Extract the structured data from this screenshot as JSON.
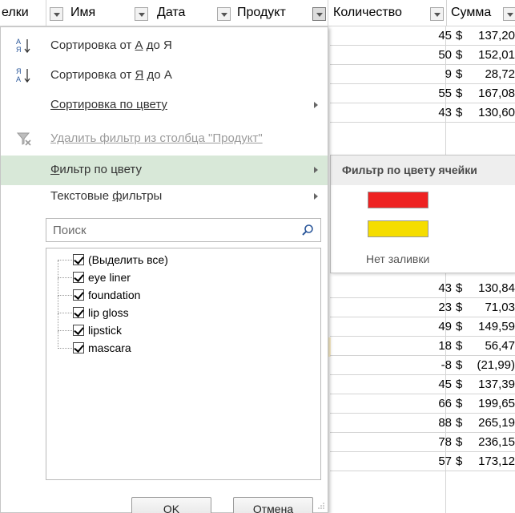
{
  "headers": {
    "col1": "елки",
    "col2": "Имя",
    "col3": "Дата",
    "col4": "Продукт",
    "col5": "Количество",
    "col6": "Сумма"
  },
  "grid_rows": [
    {
      "qty": "45",
      "amt": "137,20"
    },
    {
      "qty": "50",
      "amt": "152,01"
    },
    {
      "qty": "9",
      "amt": " 28,72"
    },
    {
      "qty": "55",
      "amt": "167,08"
    },
    {
      "qty": "43",
      "amt": "130,60"
    },
    {
      "qty": "43",
      "amt": "130,84"
    },
    {
      "qty": "23",
      "amt": " 71,03"
    },
    {
      "qty": "49",
      "amt": "149,59"
    },
    {
      "qty": "18",
      "amt": " 56,47"
    },
    {
      "qty": "-8",
      "amt": "(21,99)"
    },
    {
      "qty": "45",
      "amt": "137,39"
    },
    {
      "qty": "66",
      "amt": "199,65"
    },
    {
      "qty": "88",
      "amt": "265,19"
    },
    {
      "qty": "78",
      "amt": "236,15"
    },
    {
      "qty": "57",
      "amt": "173,12"
    }
  ],
  "currency": "$",
  "menu": {
    "sort_az_prefix": "Сортировка от ",
    "sort_az_a": "А",
    "sort_az_suffix": " до Я",
    "sort_za_prefix": "Сортировка от ",
    "sort_za_ya": "Я",
    "sort_za_suffix": " до А",
    "sort_color": "Сортировка по цвету",
    "remove_filter": "Удалить фильтр из столбца \"Продукт\"",
    "filter_color_u": "Ф",
    "filter_color": "ильтр по цвету",
    "text_filters_prefix": "Текстовые ",
    "text_filters_u": "ф",
    "text_filters_suffix": "ильтры"
  },
  "search": {
    "placeholder": "Поиск"
  },
  "list": [
    "(Выделить все)",
    "eye liner",
    "foundation",
    "lip gloss",
    "lipstick",
    "mascara"
  ],
  "buttons": {
    "ok": "OK",
    "cancel": "Отмена"
  },
  "submenu": {
    "title": "Фильтр по цвету ячейки",
    "no_fill": "Нет заливки",
    "colors": [
      "#ee2222",
      "#f5dd00"
    ]
  }
}
